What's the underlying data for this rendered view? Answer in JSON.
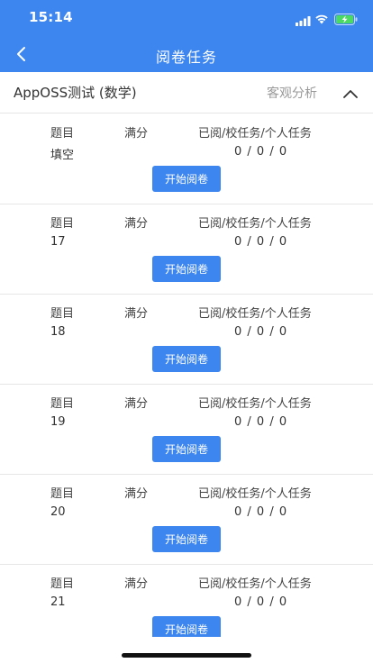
{
  "status_bar": {
    "time": "15:14",
    "icons": [
      "cellular-signal-icon",
      "wifi-icon",
      "battery-charging-icon"
    ]
  },
  "nav": {
    "title": "阅卷任务",
    "back_icon": "chevron-left-icon"
  },
  "exam": {
    "name": "AppOSS测试 (数学)",
    "analysis_label": "客观分析",
    "toggle_icon": "chevron-up-icon"
  },
  "headers": {
    "question": "题目",
    "full_score": "满分",
    "progress": "已阅/校任务/个人任务"
  },
  "tasks": [
    {
      "question": "填空",
      "full_score": "",
      "progress": "0 / 0 / 0",
      "button": "开始阅卷"
    },
    {
      "question": "17",
      "full_score": "",
      "progress": "0 / 0 / 0",
      "button": "开始阅卷"
    },
    {
      "question": "18",
      "full_score": "",
      "progress": "0 / 0 / 0",
      "button": "开始阅卷"
    },
    {
      "question": "19",
      "full_score": "",
      "progress": "0 / 0 / 0",
      "button": "开始阅卷"
    },
    {
      "question": "20",
      "full_score": "",
      "progress": "0 / 0 / 0",
      "button": "开始阅卷"
    },
    {
      "question": "21",
      "full_score": "",
      "progress": "0 / 0 / 0",
      "button": "开始阅卷"
    }
  ],
  "colors": {
    "primary": "#3d86f0",
    "divider": "#e6e6e6",
    "muted_text": "#999999"
  }
}
